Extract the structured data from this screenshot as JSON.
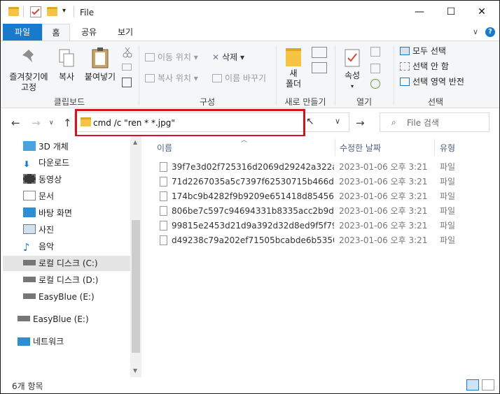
{
  "titlebar": {
    "title": "File",
    "minimize": "—",
    "maximize": "☐",
    "close": "✕"
  },
  "ribbon_tabs": {
    "file": "파일",
    "home": "홈",
    "share": "공유",
    "view": "보기",
    "help": "?"
  },
  "ribbon": {
    "clipboard": {
      "pin": "즐겨찾기에\n고정",
      "copy": "복사",
      "paste": "붙여넣기",
      "label": "클립보드"
    },
    "organize": {
      "move_to": "이동 위치",
      "copy_to": "복사 위치",
      "delete": "삭제",
      "rename": "이름 바꾸기",
      "label": "구성"
    },
    "new": {
      "new_folder": "새\n폴더",
      "label": "새로 만들기"
    },
    "open": {
      "properties": "속성",
      "label": "열기"
    },
    "select": {
      "select_all": "모두 선택",
      "select_none": "선택 안 함",
      "invert": "선택 영역 반전",
      "label": "선택"
    }
  },
  "address_bar": {
    "value": "cmd /c \"ren * *.jpg\"",
    "chevron": "∨"
  },
  "search": {
    "placeholder": "File 검색"
  },
  "nav_pane": {
    "items": [
      {
        "label": "3D 개체",
        "icon": "cube-icon"
      },
      {
        "label": "다운로드",
        "icon": "download-icon"
      },
      {
        "label": "동영상",
        "icon": "video-icon"
      },
      {
        "label": "문서",
        "icon": "document-icon"
      },
      {
        "label": "바탕 화면",
        "icon": "desktop-icon"
      },
      {
        "label": "사진",
        "icon": "pictures-icon"
      },
      {
        "label": "음악",
        "icon": "music-icon"
      },
      {
        "label": "로컬 디스크 (C:)",
        "icon": "drive-icon"
      },
      {
        "label": "로컬 디스크 (D:)",
        "icon": "drive-icon"
      },
      {
        "label": "EasyBlue (E:)",
        "icon": "drive-icon"
      },
      {
        "label": "EasyBlue (E:)",
        "icon": "drive-icon"
      },
      {
        "label": "네트워크",
        "icon": "network-icon"
      }
    ]
  },
  "file_list": {
    "columns": [
      "이름",
      "수정한 날짜",
      "유형"
    ],
    "rows": [
      {
        "name": "39f7e3d02f725316d2069d29242a322a...",
        "date": "2023-01-06 오후 3:21",
        "type": "파일"
      },
      {
        "name": "71d2267035a5c7397f62530715b466d...",
        "date": "2023-01-06 오후 3:21",
        "type": "파일"
      },
      {
        "name": "174bc9b4282f9b9209e651418d85456...",
        "date": "2023-01-06 오후 3:21",
        "type": "파일"
      },
      {
        "name": "806be7c597c94694331b8335acc2b9de...",
        "date": "2023-01-06 오후 3:21",
        "type": "파일"
      },
      {
        "name": "99815e2453d21d9a392d32d8ed9f5f79...",
        "date": "2023-01-06 오후 3:21",
        "type": "파일"
      },
      {
        "name": "d49238c79a202ef71505bcabde6b5350...",
        "date": "2023-01-06 오후 3:21",
        "type": "파일"
      }
    ]
  },
  "statusbar": {
    "count": "6개 항목"
  },
  "colors": {
    "accent": "#1979ca",
    "highlight": "#d6141c",
    "ribbon_bg": "#f5f6f7",
    "selected_bg": "#e5e5e5"
  }
}
